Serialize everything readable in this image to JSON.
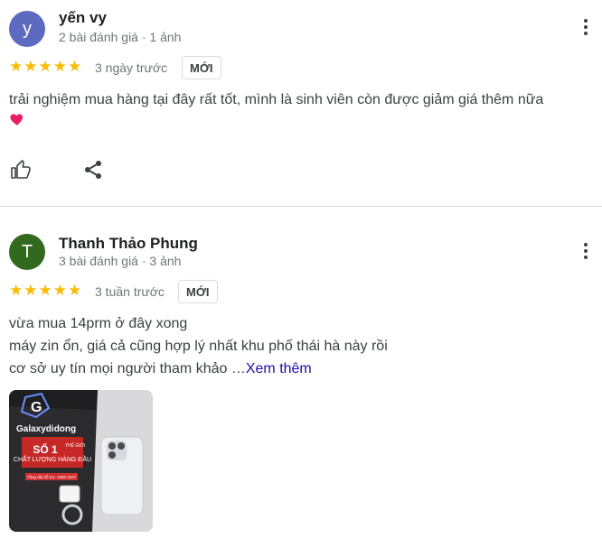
{
  "reviews": [
    {
      "avatar_letter": "y",
      "avatar_color": "#5c6bc0",
      "name": "yến vy",
      "meta": "2 bài đánh giá · 1 ảnh",
      "stars": 5,
      "time": "3 ngày trước",
      "badge": "MỚI",
      "text_line_1": "trải nghiệm mua hàng tại đây rất tốt, mình là sinh viên còn được giảm giá thêm nữa"
    },
    {
      "avatar_letter": "T",
      "avatar_color": "#33691e",
      "name": "Thanh Thảo Phung",
      "meta": "3 bài đánh giá · 3 ảnh",
      "stars": 5,
      "time": "3 tuần trước",
      "badge": "MỚI",
      "text_line_1": "vừa mua 14prm ở đây xong",
      "text_line_2": "máy zin ổn, giá cả cũng hợp lý nhất khu phố thái hà này rồi",
      "text_line_3": "cơ sở uy tín mọi người tham khảo …",
      "more_link": "Xem thêm",
      "photo": {
        "brand": "Galaxydidong",
        "headline": "SỐ 1",
        "sub_1": "THẾ GIỚI",
        "sub_2": "CHẤT LƯỢNG HÀNG ĐẦU",
        "strip": "Tổng đài hỗ trợ: 1900 0247"
      }
    }
  ],
  "icons": {
    "thumb_up": "thumb-up-icon",
    "share": "share-icon",
    "more": "more-vert-icon",
    "heart": "heart-icon",
    "star": "star-icon"
  },
  "colors": {
    "star": "#fbbc04",
    "link": "#1a0dab",
    "heart": "#e91e63"
  }
}
